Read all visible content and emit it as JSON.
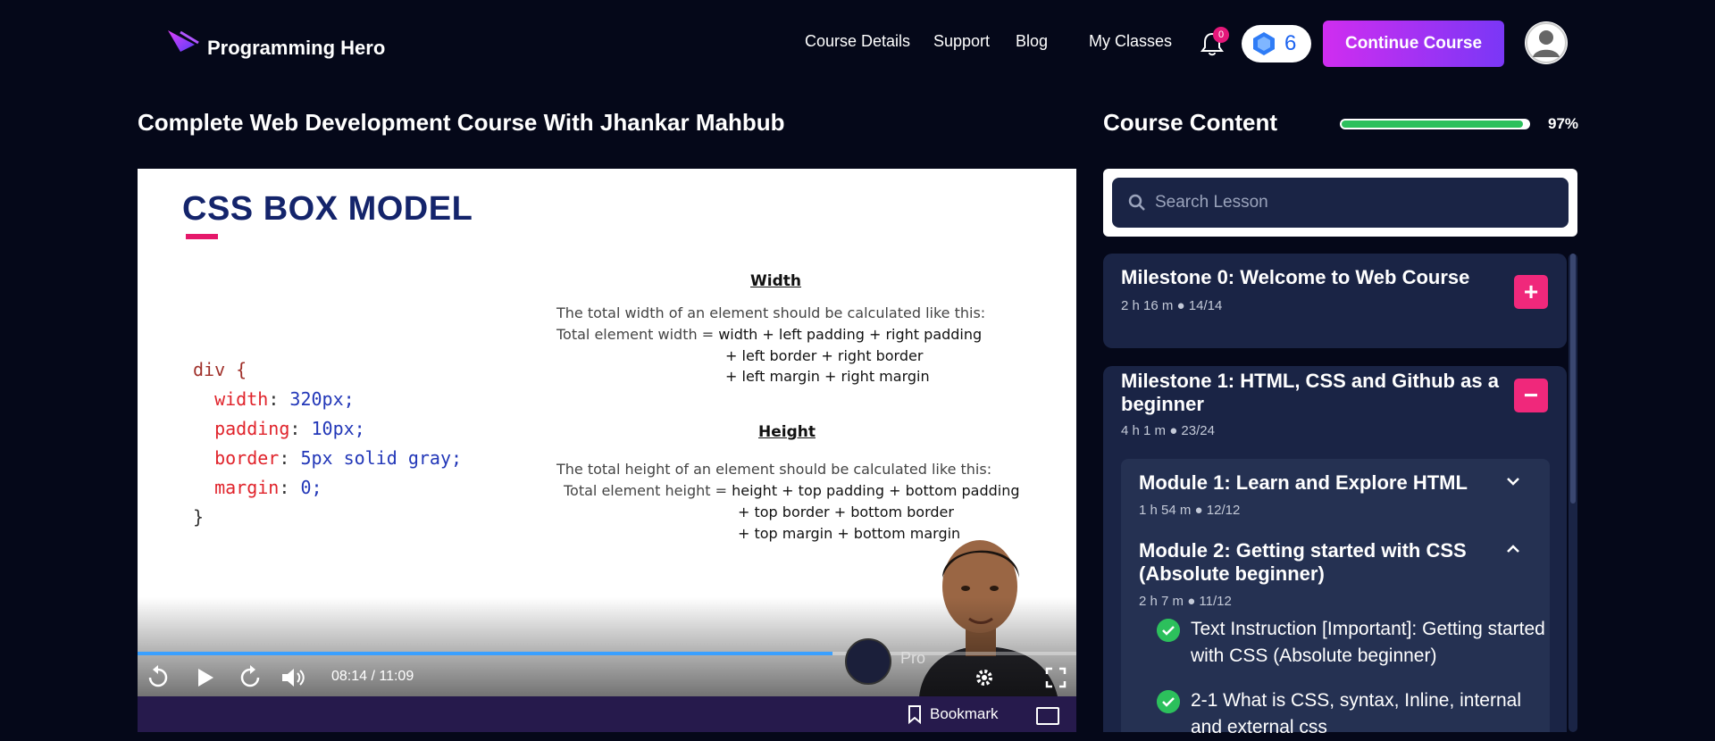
{
  "header": {
    "brand": "Programming Hero",
    "nav": [
      "Course Details",
      "Support",
      "Blog",
      "My Classes"
    ],
    "notification_count": "0",
    "gem_count": "6",
    "continue_label": "Continue Course"
  },
  "video": {
    "course_title": "Complete Web Development Course With Jhankar Mahbub",
    "slide": {
      "title": "CSS BOX MODEL",
      "code": {
        "selector": "div {",
        "lines": [
          {
            "prop": "width",
            "val": "320px;"
          },
          {
            "prop": "padding",
            "val": "10px;"
          },
          {
            "prop": "border",
            "val": "5px solid gray;"
          },
          {
            "prop": "margin",
            "val": "0;"
          }
        ],
        "close": "}"
      },
      "width_heading": "Width",
      "width_intro": "The total width of an element should be calculated like this:",
      "width_line1_label": "Total element width = ",
      "width_line1": "width  + left padding + right padding",
      "width_line2": "+ left border + right border",
      "width_line3": "+ left margin + right margin",
      "height_heading": "Height",
      "height_intro": "The total height of an element should be calculated like this:",
      "height_line1_label": "Total element height = ",
      "height_line1": "height + top padding + bottom padding",
      "height_line2": "+ top border + bottom border",
      "height_line3": "+ top margin + bottom margin"
    },
    "brand_overlay": "Pro",
    "current_time": "08:14 / 11:09",
    "progress_fraction": 0.74,
    "bookmark_label": "Bookmark"
  },
  "course_content": {
    "title": "Course Content",
    "progress_percent": 97,
    "progress_label": "97%",
    "search_placeholder": "Search Lesson",
    "milestones": [
      {
        "title": "Milestone 0: Welcome to Web Course",
        "meta": "2 h 16 m ●  14/14",
        "toggle": "+"
      },
      {
        "title": "Milestone 1: HTML, CSS and Github as a beginner",
        "meta": "4 h 1 m ●  23/24",
        "toggle": "−"
      }
    ],
    "modules": [
      {
        "title": "Module 1: Learn and Explore HTML",
        "meta": "1 h 54 m ●  12/12"
      },
      {
        "title": "Module 2: Getting started with CSS (Absolute beginner)",
        "meta": "2 h 7 m ●  11/12"
      }
    ],
    "lessons": [
      "Text Instruction [Important]: Getting started with CSS (Absolute beginner)",
      "2-1 What is CSS, syntax, Inline, internal and external css"
    ]
  },
  "colors": {
    "background": "#050819",
    "accent_pink": "#f0287b",
    "accent_purple": "#7a37f6",
    "progress_green": "#2cc05c",
    "panel": "#1a2445"
  }
}
